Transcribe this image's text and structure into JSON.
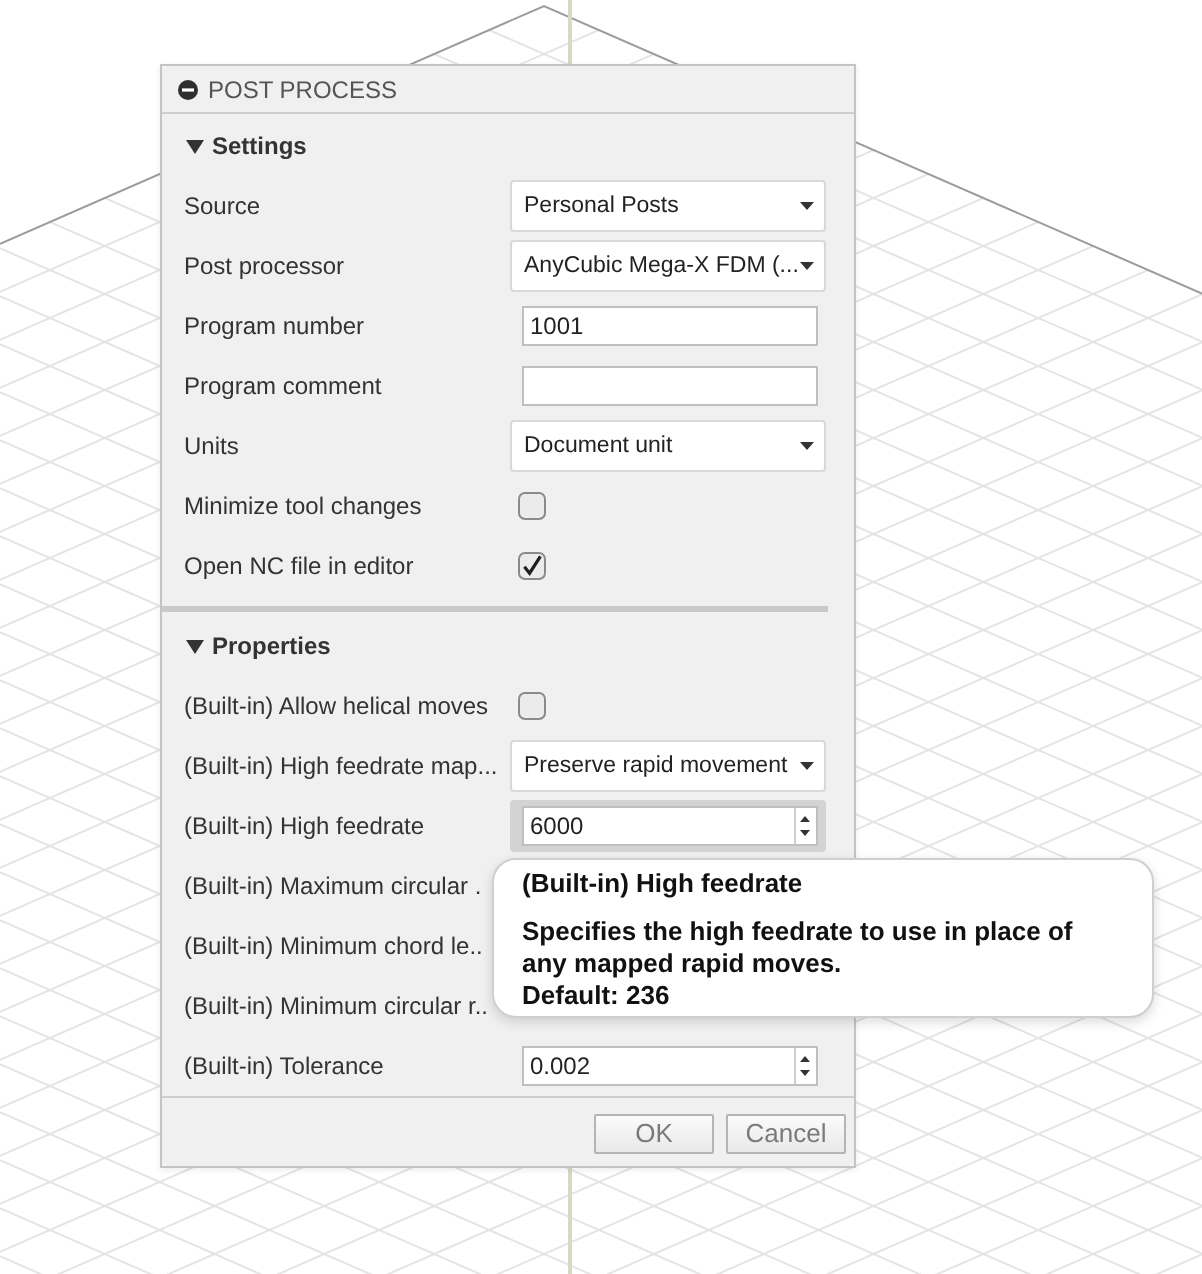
{
  "window": {
    "title": "POST PROCESS"
  },
  "sections": [
    {
      "title": "Settings",
      "expanded": true,
      "rows": [
        {
          "label": "Source",
          "kind": "dropdown",
          "value": "Personal Posts"
        },
        {
          "label": "Post processor",
          "kind": "dropdown",
          "value": "AnyCubic Mega-X FDM (..."
        },
        {
          "label": "Program number",
          "kind": "text",
          "value": "1001"
        },
        {
          "label": "Program comment",
          "kind": "text"
        },
        {
          "label": "Units",
          "kind": "dropdown",
          "value": "Document unit"
        },
        {
          "label": "Minimize tool changes",
          "kind": "checkbox",
          "checked": false
        },
        {
          "label": "Open NC file in editor",
          "kind": "checkbox",
          "checked": true
        }
      ]
    },
    {
      "title": "Properties",
      "expanded": true,
      "rows": [
        {
          "label": "(Built-in) Allow helical moves",
          "kind": "checkbox",
          "checked": false
        },
        {
          "label": "(Built-in) High feedrate map...",
          "kind": "dropdown",
          "value": "Preserve rapid movement"
        },
        {
          "label": "(Built-in) High feedrate",
          "kind": "spin",
          "value": "6000",
          "focused": true
        },
        {
          "label": "(Built-in) Maximum circular .",
          "kind": "covered"
        },
        {
          "label": "(Built-in) Minimum chord le..",
          "kind": "covered"
        },
        {
          "label": "(Built-in) Minimum circular r..",
          "kind": "covered"
        },
        {
          "label": "(Built-in) Tolerance",
          "kind": "spin",
          "value": "0.002",
          "focused": false
        }
      ]
    }
  ],
  "tooltip": {
    "title": "(Built-in) High feedrate",
    "text": "Specifies the high feedrate to use in place of any mapped rapid moves.",
    "default_line": "Default: 236"
  },
  "buttons": [
    {
      "label": "OK"
    },
    {
      "label": "Cancel"
    }
  ]
}
